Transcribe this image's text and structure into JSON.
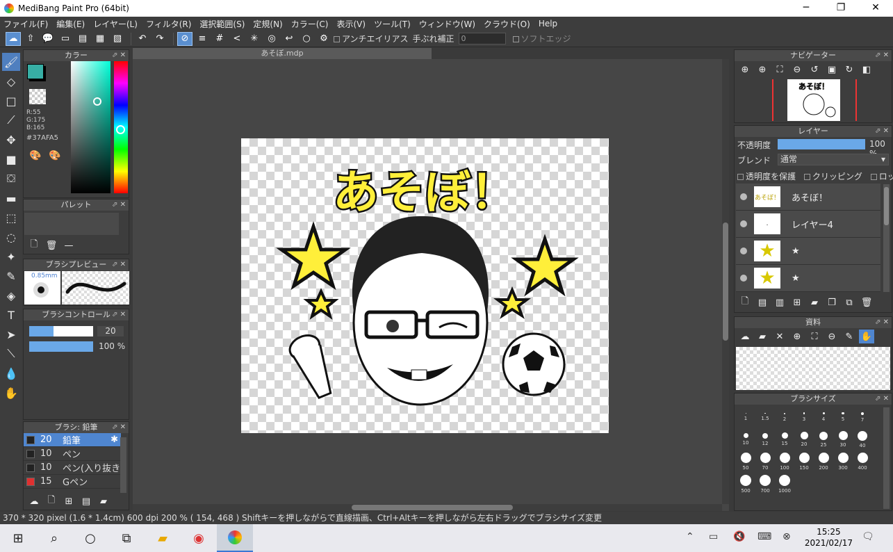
{
  "window": {
    "title": "MediBang Paint Pro (64bit)",
    "minimize": "─",
    "maximize": "❐",
    "close": "✕"
  },
  "menu": [
    "ファイル(F)",
    "編集(E)",
    "レイヤー(L)",
    "フィルタ(R)",
    "選択範囲(S)",
    "定規(N)",
    "カラー(C)",
    "表示(V)",
    "ツール(T)",
    "ウィンドウ(W)",
    "クラウド(O)",
    "Help"
  ],
  "toolbar": {
    "antialias": "アンチエイリアス",
    "stabilizer_label": "手ぶれ補正",
    "stabilizer_value": "0",
    "soft_edge": "ソフトエッジ"
  },
  "color_panel": {
    "title": "カラー",
    "r": "R:55",
    "g": "G:175",
    "b": "B:165",
    "hex": "#37AFA5",
    "current": "#37afa5"
  },
  "palette_panel": {
    "title": "パレット"
  },
  "brush_preview": {
    "title": "ブラシプレビュー",
    "size": "0.85mm"
  },
  "brush_control": {
    "title": "ブラシコントロール",
    "size": "20",
    "opacity": "100 %"
  },
  "brush_panel": {
    "title": "ブラシ: 鉛筆",
    "items": [
      {
        "size": "20",
        "name": "鉛筆",
        "color": "#222222",
        "selected": true
      },
      {
        "size": "10",
        "name": "ペン",
        "color": "#222222"
      },
      {
        "size": "10",
        "name": "ペン(入り抜き",
        "color": "#222222"
      },
      {
        "size": "15",
        "name": "Gペン",
        "color": "#e03030"
      }
    ]
  },
  "document": {
    "tab": "あそぼ.mdp",
    "artwork_text": "あそぼ！"
  },
  "navigator": {
    "title": "ナビゲーター"
  },
  "layers": {
    "title": "レイヤー",
    "opacity_label": "不透明度",
    "opacity_value": "100 %",
    "opacity_pct": 100,
    "blend_label": "ブレンド",
    "blend_value": "通常",
    "protect": "透明度を保護",
    "clipping": "クリッピング",
    "lock": "ロック",
    "items": [
      {
        "name": "あそぼ！",
        "thumb": "あそぼ！"
      },
      {
        "name": "レイヤー4",
        "thumb": "."
      },
      {
        "name": "★",
        "thumb": "★"
      },
      {
        "name": "★",
        "thumb": "★"
      }
    ]
  },
  "materials": {
    "title": "資料"
  },
  "brush_size": {
    "title": "ブラシサイズ",
    "sizes": [
      "1",
      "1.5",
      "2",
      "3",
      "4",
      "5",
      "7",
      "10",
      "12",
      "15",
      "20",
      "25",
      "30",
      "40",
      "50",
      "70",
      "100",
      "150",
      "200",
      "300",
      "400",
      "500",
      "700",
      "1000"
    ]
  },
  "status": "370 * 320 pixel   (1.6 * 1.4cm)   600 dpi   200 %   ( 154, 468 )   Shiftキーを押しながらで直線描画、Ctrl+Altキーを押しながら左右ドラッグでブラシサイズ変更",
  "taskbar": {
    "time": "15:25",
    "date": "2021/02/17"
  }
}
